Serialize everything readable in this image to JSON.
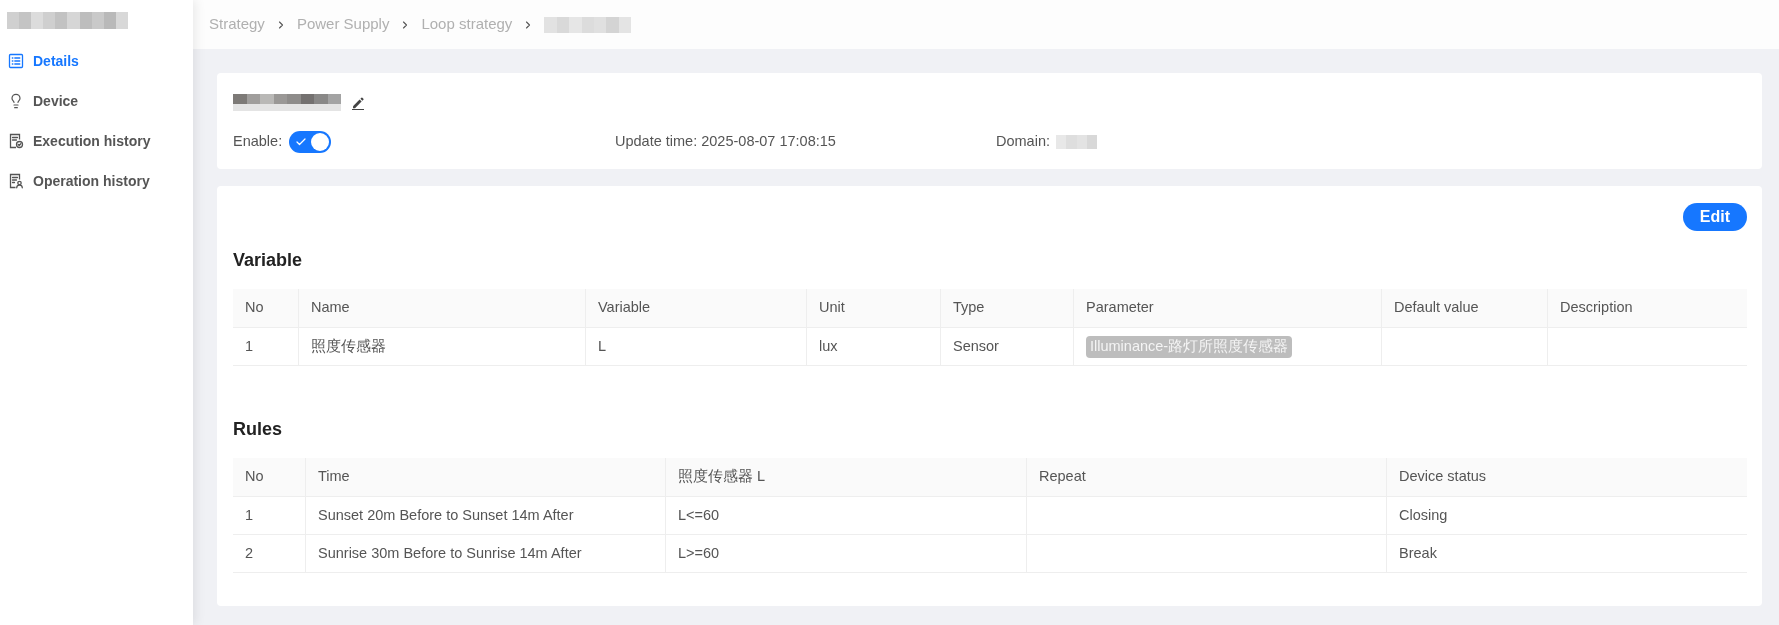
{
  "sidebar": {
    "items": [
      {
        "label": "Details",
        "selected": true
      },
      {
        "label": "Device",
        "selected": false
      },
      {
        "label": "Execution history",
        "selected": false
      },
      {
        "label": "Operation history",
        "selected": false
      }
    ]
  },
  "breadcrumb": {
    "items": [
      "Strategy",
      "Power Supply",
      "Loop strategy"
    ]
  },
  "header": {
    "enable_label": "Enable:",
    "enabled": true,
    "update_time": "Update time: 2025-08-07 17:08:15",
    "domain_label": "Domain:"
  },
  "edit_button": {
    "label": "Edit"
  },
  "variable": {
    "title": "Variable",
    "columns": [
      "No",
      "Name",
      "Variable",
      "Unit",
      "Type",
      "Parameter",
      "Default value",
      "Description"
    ],
    "rows": [
      {
        "no": "1",
        "name": "照度传感器",
        "variable": "L",
        "unit": "lux",
        "type": "Sensor",
        "parameter": "Illuminance-路灯所照度传感器"
      }
    ]
  },
  "rules": {
    "title": "Rules",
    "columns": [
      "No",
      "Time",
      "照度传感器 L",
      "Repeat",
      "Device status"
    ],
    "rows": [
      {
        "no": "1",
        "time": "Sunset 20m Before to Sunset 14m After",
        "sensor_condition": "L<=60",
        "device_status": "Closing"
      },
      {
        "no": "2",
        "time": "Sunrise 30m Before to Sunrise 14m After",
        "sensor_condition": "L>=60",
        "device_status": "Break"
      }
    ]
  }
}
